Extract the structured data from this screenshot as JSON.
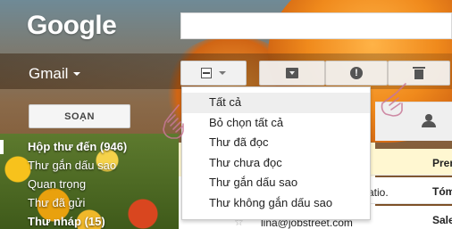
{
  "header": {
    "logo_text": "Google",
    "search": {
      "value": "",
      "placeholder": ""
    }
  },
  "app": {
    "name": "Gmail"
  },
  "toolbar": {
    "select_icon": "checkbox-indeterminate-icon",
    "archive_icon": "archive-icon",
    "spam_icon": "report-spam-icon",
    "spam_glyph": "!",
    "delete_icon": "trash-icon"
  },
  "compose": {
    "label": "SOẠN"
  },
  "nav": {
    "items": [
      {
        "label": "Hộp thư đến (946)",
        "active": true
      },
      {
        "label": "Thư gắn dấu sao"
      },
      {
        "label": "Quan trọng"
      },
      {
        "label": "Thư đã gửi"
      },
      {
        "label": "Thư nháp (15)",
        "bold": true
      }
    ]
  },
  "select_menu": {
    "items": [
      {
        "label": "Tất cả",
        "hover": true
      },
      {
        "label": "Bỏ chọn tất cả"
      },
      {
        "label": "Thư đã đọc"
      },
      {
        "label": "Thư chưa đọc"
      },
      {
        "label": "Thư gắn dấu sao"
      },
      {
        "label": "Thư không gắn dấu sao"
      }
    ]
  },
  "mail_rows": [
    {
      "sender": "",
      "subject": "Pren"
    },
    {
      "sender": "atio.",
      "subject": "Tóm"
    },
    {
      "sender": "lina@jobstreet.com",
      "subject": "Sale"
    }
  ],
  "colors": {
    "nav_text": "#ffffff",
    "menu_hover": "#eeeeee",
    "unread_row": "#fff7d1"
  }
}
